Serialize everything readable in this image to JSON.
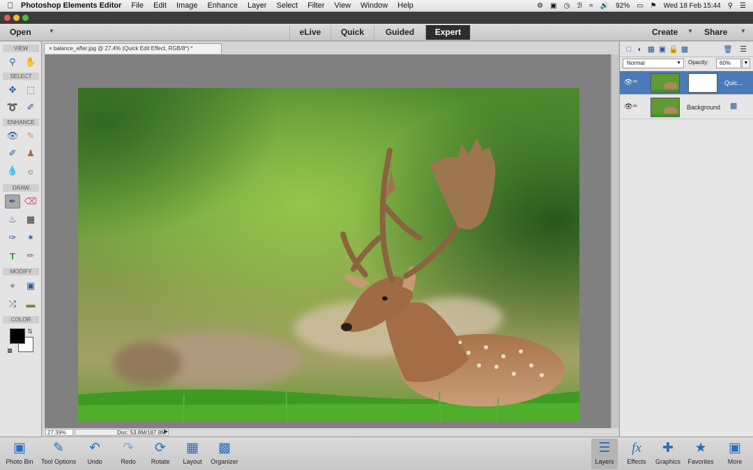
{
  "menubar": {
    "app_name": "Photoshop Elements Editor",
    "menus": [
      "File",
      "Edit",
      "Image",
      "Enhance",
      "Layer",
      "Select",
      "Filter",
      "View",
      "Window",
      "Help"
    ],
    "battery": "92%",
    "datetime": "Wed 18 Feb  15:44"
  },
  "modebar": {
    "open_label": "Open",
    "tabs": [
      "eLive",
      "Quick",
      "Guided",
      "Expert"
    ],
    "active_tab": "Expert",
    "create_label": "Create",
    "share_label": "Share"
  },
  "toolbox": {
    "sections": [
      "VIEW",
      "SELECT",
      "ENHANCE",
      "DRAW",
      "MODIFY",
      "COLOR"
    ],
    "tools": {
      "zoom": "zoom-icon",
      "hand": "hand-icon",
      "move": "move-icon",
      "marquee": "marquee-icon",
      "lasso": "lasso-icon",
      "quick_select": "quick-selection-icon",
      "red_eye": "red-eye-icon",
      "spot_heal": "spot-healing-icon",
      "smart_brush": "smart-brush-icon",
      "clone_stamp": "clone-stamp-icon",
      "blur": "blur-icon",
      "sponge": "sponge-icon",
      "brush": "brush-icon",
      "eraser": "eraser-icon",
      "paint_bucket": "paint-bucket-icon",
      "gradient": "gradient-icon",
      "eyedropper": "eyedropper-icon",
      "custom_shape": "custom-shape-icon",
      "type": "type-icon",
      "pencil": "pencil-icon",
      "crop": "crop-icon",
      "recompose": "recompose-icon",
      "content_move": "content-aware-move-icon",
      "straighten": "straighten-icon"
    },
    "active_tool": "brush",
    "foreground_color": "#000000",
    "background_color": "#ffffff"
  },
  "document": {
    "tab_title": "balance_after.jpg @ 27.4% (Quick Edit Effect, RGB/8*) *",
    "zoom": "27.39%",
    "doc_size": "Doc: 53.8M/187.8M"
  },
  "layers_panel": {
    "blend_mode": "Normal",
    "opacity_label": "Opacity:",
    "opacity_value": "60%",
    "layers": [
      {
        "name": "Quic...",
        "selected": true
      },
      {
        "name": "Background",
        "selected": false
      }
    ]
  },
  "bottombar": {
    "left": [
      {
        "label": "Photo Bin",
        "icon": "photo-bin-icon"
      },
      {
        "label": "Tool Options",
        "icon": "tool-options-icon"
      },
      {
        "label": "Undo",
        "icon": "undo-icon"
      },
      {
        "label": "Redo",
        "icon": "redo-icon"
      },
      {
        "label": "Rotate",
        "icon": "rotate-icon"
      },
      {
        "label": "Layout",
        "icon": "layout-icon"
      },
      {
        "label": "Organizer",
        "icon": "organizer-icon"
      }
    ],
    "right": [
      {
        "label": "Layers",
        "icon": "layers-icon"
      },
      {
        "label": "Effects",
        "icon": "effects-icon"
      },
      {
        "label": "Graphics",
        "icon": "graphics-icon"
      },
      {
        "label": "Favorites",
        "icon": "favorites-icon"
      },
      {
        "label": "More",
        "icon": "more-icon"
      }
    ],
    "active": "Layers"
  }
}
